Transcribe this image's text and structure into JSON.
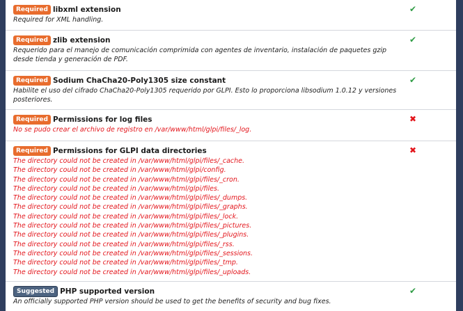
{
  "checks": [
    {
      "badge": "Required",
      "title": "libxml extension",
      "description": "Required for XML handling.",
      "status_icon": "✔"
    },
    {
      "badge": "Required",
      "title": "zlib extension",
      "description": "Requerido para el manejo de comunicación comprimida con agentes de inventario, instalación de paquetes gzip desde tienda y generación de PDF.",
      "status_icon": "✔"
    },
    {
      "badge": "Required",
      "title": "Sodium ChaCha20-Poly1305 size constant",
      "description": "Habilite el uso del cifrado ChaCha20-Poly1305 requerido por GLPI. Esto lo proporciona libsodium 1.0.12 y versiones posteriores.",
      "status_icon": "✔"
    },
    {
      "badge": "Required",
      "title": "Permissions for log files",
      "error": "No se pudo crear el archivo de registro en /var/www/html/glpi/files/_log.",
      "status_icon": "✖"
    },
    {
      "badge": "Required",
      "title": "Permissions for GLPI data directories",
      "errors": [
        "The directory could not be created in /var/www/html/glpi/files/_cache.",
        "The directory could not be created in /var/www/html/glpi/config.",
        "The directory could not be created in /var/www/html/glpi/files/_cron.",
        "The directory could not be created in /var/www/html/glpi/files.",
        "The directory could not be created in /var/www/html/glpi/files/_dumps.",
        "The directory could not be created in /var/www/html/glpi/files/_graphs.",
        "The directory could not be created in /var/www/html/glpi/files/_lock.",
        "The directory could not be created in /var/www/html/glpi/files/_pictures.",
        "The directory could not be created in /var/www/html/glpi/files/_plugins.",
        "The directory could not be created in /var/www/html/glpi/files/_rss.",
        "The directory could not be created in /var/www/html/glpi/files/_sessions.",
        "The directory could not be created in /var/www/html/glpi/files/_tmp.",
        "The directory could not be created in /var/www/html/glpi/files/_uploads."
      ],
      "status_icon": "✖"
    },
    {
      "badge": "Suggested",
      "title": "PHP supported version",
      "description": "An officially supported PHP version should be used to get the benefits of security and bug fixes.",
      "status_icon": "✔"
    }
  ],
  "colors": {
    "required_badge": "#e86c2d",
    "suggested_badge": "#4d6380",
    "ok": "#2f9c45",
    "error": "#e3151b",
    "frame": "#2f3e5e"
  }
}
